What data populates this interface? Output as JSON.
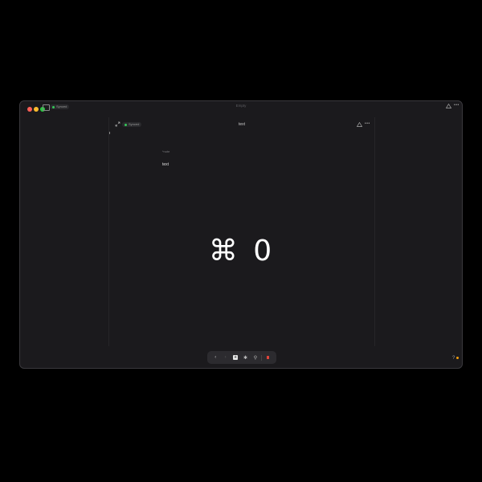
{
  "window": {
    "title": "Empty",
    "sync_status": "Synced"
  },
  "document": {
    "title": "text",
    "sync_status": "Synced",
    "note_label": "*note",
    "body": "text"
  },
  "overlay": {
    "shortcut": "⌘ 0"
  },
  "toolbar": {
    "back_label": "‹",
    "forward_label": "›",
    "new_label": "+",
    "settings_label": "✱",
    "search_label": "⚲"
  },
  "help": {
    "label": "?"
  },
  "colors": {
    "background": "#000000",
    "window": "#1b1a1d",
    "accent_green": "#35c759",
    "notification_orange": "#f59e0b",
    "record_red": "#e0443a"
  }
}
